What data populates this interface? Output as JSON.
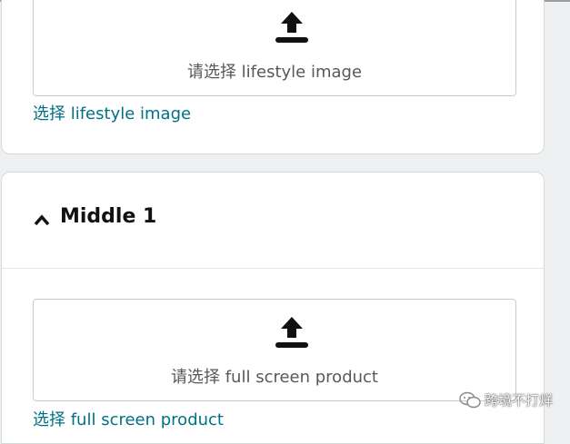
{
  "top_card": {
    "drop_label": "请选择 lifestyle image",
    "link_label": "选择 lifestyle image",
    "icon": "upload-icon"
  },
  "middle_card": {
    "title": "Middle 1",
    "toggle_icon": "chevron-up-icon",
    "drop_label": "请选择 full screen product",
    "link_label": "选择 full screen product",
    "icon": "upload-icon"
  },
  "watermark": {
    "text": "跨境不打烊",
    "icon": "wechat-logo"
  },
  "colors": {
    "link": "#007185",
    "placeholder_text": "#565959",
    "title": "#111111",
    "background": "#eef0f2"
  }
}
